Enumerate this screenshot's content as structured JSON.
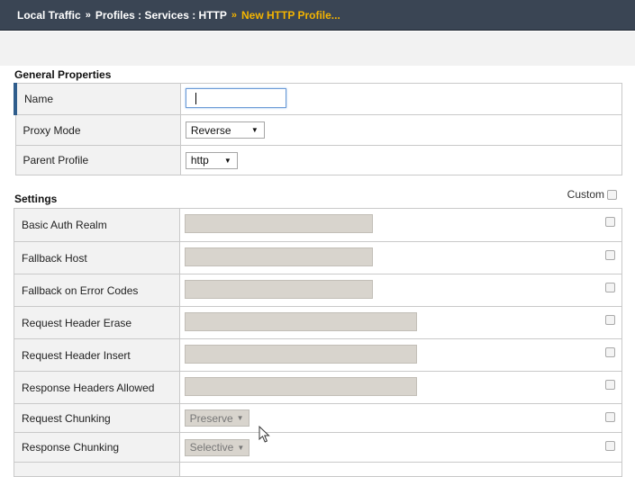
{
  "breadcrumb": {
    "part1": "Local Traffic",
    "sep1": "»",
    "part2": "Profiles : Services : HTTP",
    "sep2": "»",
    "current": "New HTTP Profile..."
  },
  "general": {
    "title": "General Properties",
    "rows": [
      {
        "label": "Name",
        "type": "text",
        "value": ""
      },
      {
        "label": "Proxy Mode",
        "type": "select",
        "value": "Reverse"
      },
      {
        "label": "Parent Profile",
        "type": "select",
        "value": "http"
      }
    ]
  },
  "settings": {
    "title": "Settings",
    "custom_label": "Custom",
    "rows": [
      {
        "label": "Basic Auth Realm"
      },
      {
        "label": "Fallback Host"
      },
      {
        "label": "Fallback on Error Codes"
      },
      {
        "label": "Request Header Erase"
      },
      {
        "label": "Request Header Insert"
      },
      {
        "label": "Response Headers Allowed"
      },
      {
        "label": "Request Chunking",
        "value": "Preserve"
      },
      {
        "label": "Response Chunking",
        "value": "Selective"
      }
    ]
  },
  "icons": {
    "dropdown": "chevron-down-icon",
    "pointer": "mouse-pointer-icon"
  },
  "colors": {
    "header_bg": "#3a4554",
    "breadcrumb_current": "#f4b400",
    "disabled_field": "#d8d4cd",
    "focus_border": "#6b9ad6"
  }
}
